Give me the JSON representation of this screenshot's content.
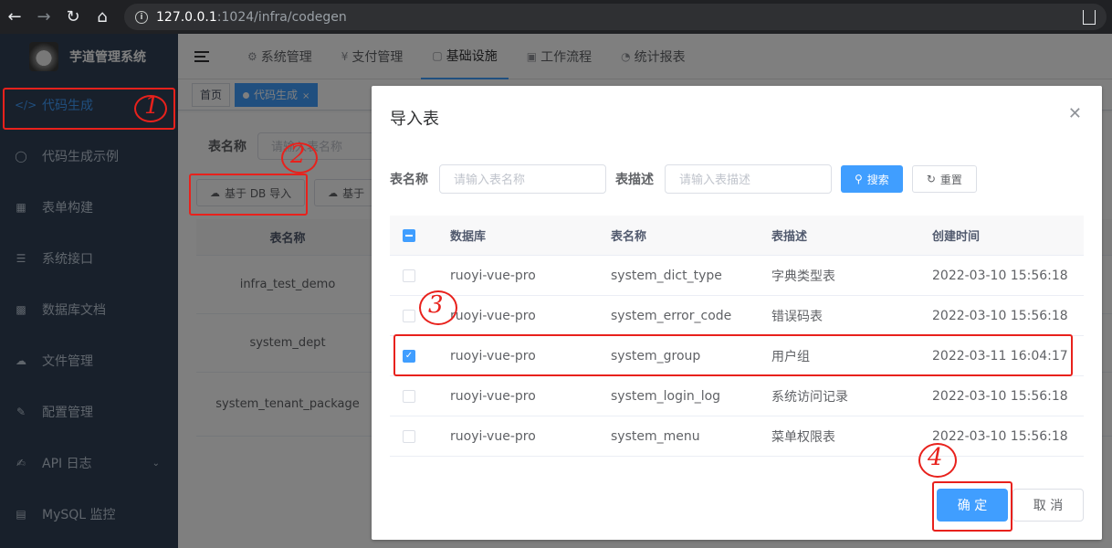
{
  "browser": {
    "url_host": "127.0.0.1",
    "url_rest": ":1024/infra/codegen"
  },
  "sidebar": {
    "app_title": "芋道管理系统",
    "items": [
      {
        "label": "代码生成",
        "icon": "code-icon"
      },
      {
        "label": "代码生成示例",
        "icon": "shield-icon"
      },
      {
        "label": "表单构建",
        "icon": "grid-icon"
      },
      {
        "label": "系统接口",
        "icon": "sliders-icon"
      },
      {
        "label": "数据库文档",
        "icon": "table-icon"
      },
      {
        "label": "文件管理",
        "icon": "cloud-upload-icon"
      },
      {
        "label": "配置管理",
        "icon": "edit-icon"
      },
      {
        "label": "API 日志",
        "icon": "document-edit-icon"
      },
      {
        "label": "MySQL 监控",
        "icon": "monitor-icon"
      }
    ]
  },
  "topnav": {
    "items": [
      {
        "label": "系统管理"
      },
      {
        "label": "支付管理"
      },
      {
        "label": "基础设施"
      },
      {
        "label": "工作流程"
      },
      {
        "label": "统计报表"
      }
    ]
  },
  "tags": {
    "home": "首页",
    "current": "代码生成"
  },
  "page": {
    "search_label": "表名称",
    "search_placeholder": "请输入表名称",
    "import_button": "基于 DB 导入",
    "import_button2": "基于",
    "table_header": "表名称",
    "rows": [
      "infra_test_demo",
      "system_dept",
      "system_tenant_package"
    ]
  },
  "dialog": {
    "title": "导入表",
    "table_name_label": "表名称",
    "table_name_placeholder": "请输入表名称",
    "table_desc_label": "表描述",
    "table_desc_placeholder": "请输入表描述",
    "search_button": "搜索",
    "reset_button": "重置",
    "columns": [
      "数据库",
      "表名称",
      "表描述",
      "创建时间"
    ],
    "rows": [
      {
        "db": "ruoyi-vue-pro",
        "name": "system_dict_type",
        "desc": "字典类型表",
        "time": "2022-03-10 15:56:18",
        "checked": false
      },
      {
        "db": "ruoyi-vue-pro",
        "name": "system_error_code",
        "desc": "错误码表",
        "time": "2022-03-10 15:56:18",
        "checked": false
      },
      {
        "db": "ruoyi-vue-pro",
        "name": "system_group",
        "desc": "用户组",
        "time": "2022-03-11 16:04:17",
        "checked": true
      },
      {
        "db": "ruoyi-vue-pro",
        "name": "system_login_log",
        "desc": "系统访问记录",
        "time": "2022-03-10 15:56:18",
        "checked": false
      },
      {
        "db": "ruoyi-vue-pro",
        "name": "system_menu",
        "desc": "菜单权限表",
        "time": "2022-03-10 15:56:18",
        "checked": false
      }
    ],
    "ok_button": "确 定",
    "cancel_button": "取 消"
  },
  "annotations": [
    "1",
    "2",
    "3",
    "4"
  ],
  "colors": {
    "primary": "#409eff",
    "sidebar_bg": "#304156",
    "annotation": "#e8211c"
  }
}
